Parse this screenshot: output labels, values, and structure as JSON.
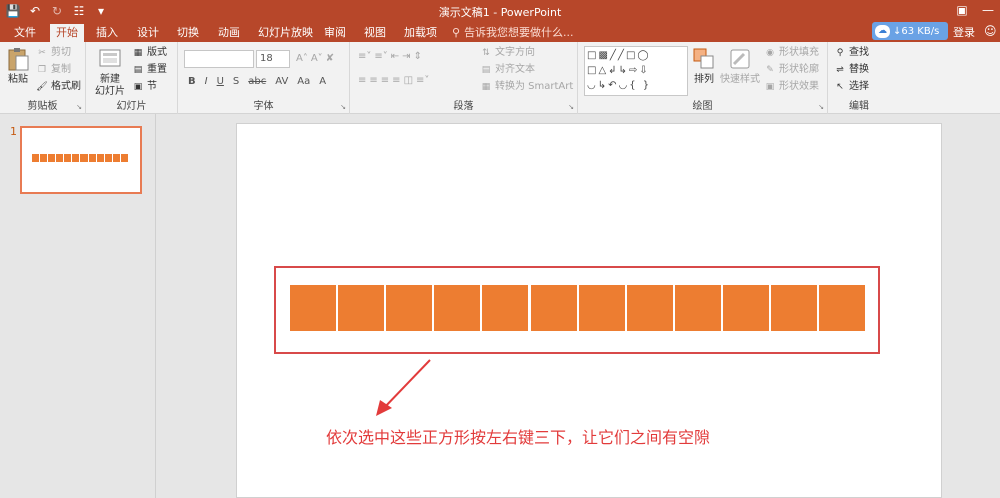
{
  "window": {
    "title": "演示文稿1 - PowerPoint",
    "qat": [
      "save-icon",
      "undo-icon",
      "redo-icon",
      "customize-icon",
      "more-icon"
    ]
  },
  "tabs": [
    "文件",
    "开始",
    "插入",
    "设计",
    "切换",
    "动画",
    "幻灯片放映",
    "审阅",
    "视图",
    "加载项"
  ],
  "active_tab": "开始",
  "tell_me": "告诉我您想要做什么...",
  "network_speed": "↓63 KB/s",
  "login_label": "登录",
  "clipboard": {
    "paste": "粘贴",
    "cut": "剪切",
    "copy": "复制",
    "format_painter": "格式刷",
    "label": "剪贴板"
  },
  "slides": {
    "new_slide": "新建",
    "new_slide2": "幻灯片",
    "layout": "版式",
    "reset": "重置",
    "section": "节",
    "label": "幻灯片"
  },
  "font": {
    "size": "18",
    "label": "字体",
    "format_buttons": [
      "B",
      "I",
      "U",
      "S",
      "abc",
      "AV",
      "Aa",
      "A"
    ]
  },
  "paragraph": {
    "text_direction": "文字方向",
    "align_text": "对齐文本",
    "smartart": "转换为 SmartArt",
    "label": "段落"
  },
  "drawing": {
    "arrange": "排列",
    "quick_styles": "快速样式",
    "shape_fill": "形状填充",
    "shape_outline": "形状轮廓",
    "shape_effects": "形状效果",
    "label": "绘图"
  },
  "editing": {
    "find": "查找",
    "replace": "替换",
    "select": "选择",
    "label": "编辑"
  },
  "slide_panel": {
    "number": "1"
  },
  "slide_content": {
    "square_count": 12,
    "square_color": "#ed7d31",
    "annotation": "依次选中这些正方形按左右键三下，让它们之间有空隙",
    "annotation_color": "#e23b3b",
    "box_color": "#d84a4a"
  },
  "colors": {
    "titlebar": "#b7472a",
    "ribbon": "#f2f2f2"
  }
}
